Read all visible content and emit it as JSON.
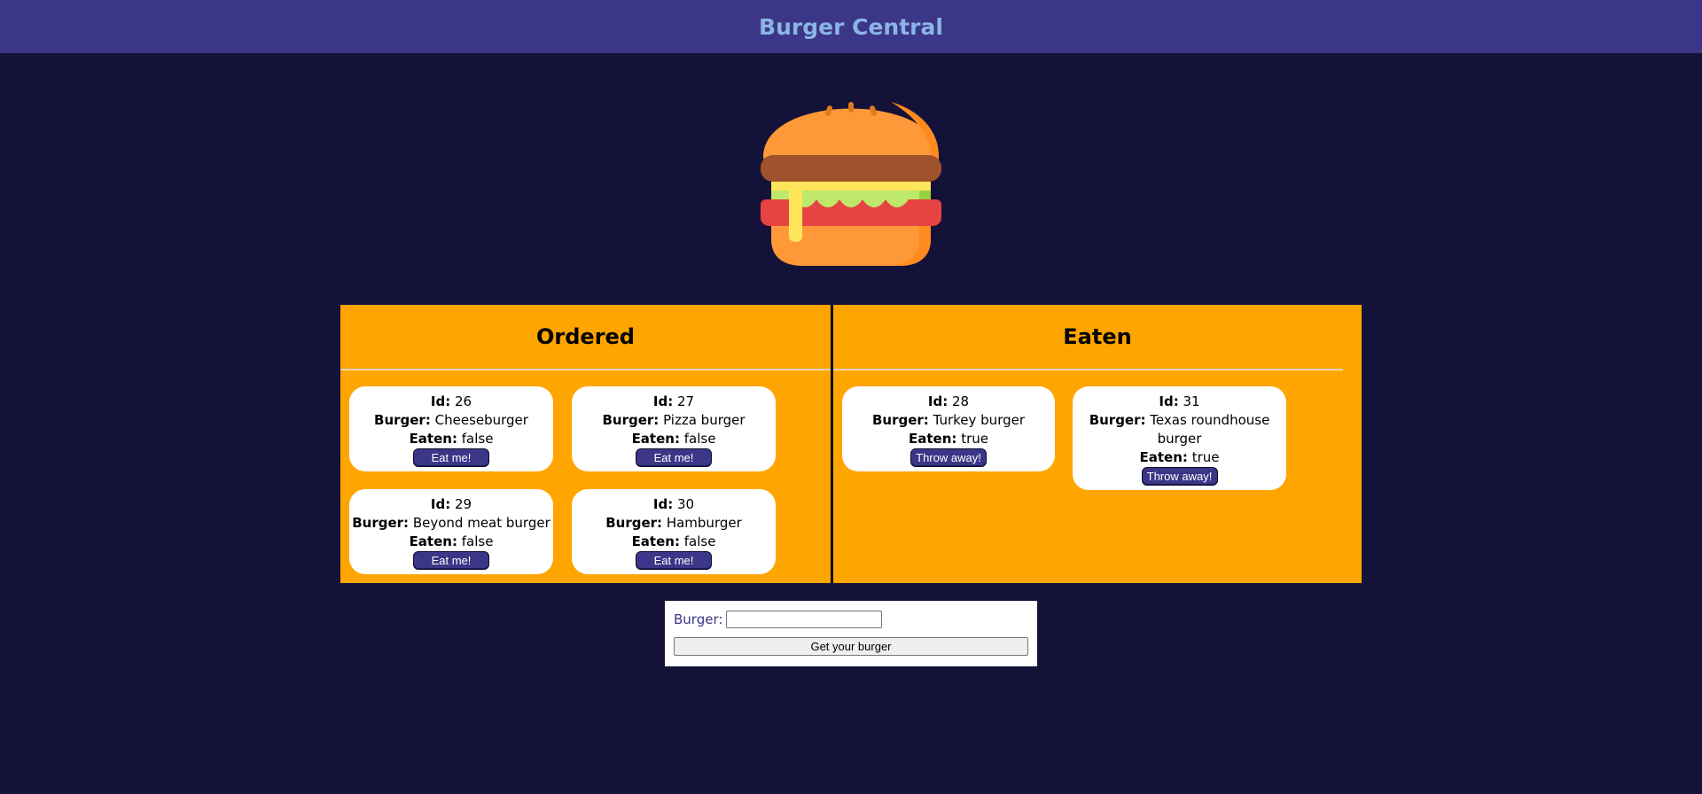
{
  "navbar": {
    "title": "Burger Central"
  },
  "ordered": {
    "title": "Ordered",
    "items": [
      {
        "id_label": "Id:",
        "id": "26",
        "burger_label": "Burger:",
        "burger": "Cheeseburger",
        "eaten_label": "Eaten:",
        "eaten": "false",
        "button": "Eat me!"
      },
      {
        "id_label": "Id:",
        "id": "27",
        "burger_label": "Burger:",
        "burger": "Pizza burger",
        "eaten_label": "Eaten:",
        "eaten": "false",
        "button": "Eat me!"
      },
      {
        "id_label": "Id:",
        "id": "29",
        "burger_label": "Burger:",
        "burger": "Beyond meat burger",
        "eaten_label": "Eaten:",
        "eaten": "false",
        "button": "Eat me!"
      },
      {
        "id_label": "Id:",
        "id": "30",
        "burger_label": "Burger:",
        "burger": "Hamburger",
        "eaten_label": "Eaten:",
        "eaten": "false",
        "button": "Eat me!"
      }
    ]
  },
  "eaten": {
    "title": "Eaten",
    "items": [
      {
        "id_label": "Id:",
        "id": "28",
        "burger_label": "Burger:",
        "burger": "Turkey burger",
        "eaten_label": "Eaten:",
        "eaten": "true",
        "button": "Throw away!"
      },
      {
        "id_label": "Id:",
        "id": "31",
        "burger_label": "Burger:",
        "burger": "Texas roundhouse burger",
        "eaten_label": "Eaten:",
        "eaten": "true",
        "button": "Throw away!"
      }
    ]
  },
  "form": {
    "label": "Burger:",
    "input_value": "",
    "submit_label": "Get your burger"
  },
  "icons": {
    "logo": "burger-icon"
  },
  "colors": {
    "background": "#141238",
    "navbar": "#3b3687",
    "title_text": "#8cb4e6",
    "board": "#ffa500",
    "button": "#3b3687"
  }
}
